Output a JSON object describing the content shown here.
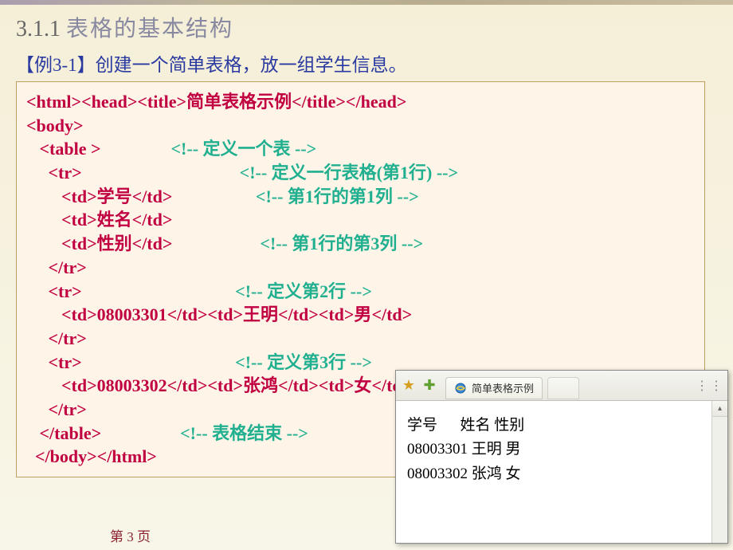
{
  "section": {
    "number": "3.1.1",
    "title": "表格的基本结构"
  },
  "example": {
    "label": "【例3-1】创建一个简单表格，放一组学生信息。"
  },
  "code": {
    "l1a": "<html><head><title>",
    "l1b": "简单表格示例",
    "l1c": "</title></head>",
    "l2": "<body>",
    "l3a": "   <table >",
    "l3b": "                <!-- 定义一个表 -->",
    "l4a": "     <tr>",
    "l4b": "                                    <!-- 定义一行表格(第1行) -->",
    "l5a": "        <td>",
    "l5b": "学号",
    "l5c": "</td>",
    "l5d": "                   <!-- 第1行的第1列 -->",
    "l6a": "        <td>",
    "l6b": "姓名",
    "l6c": "</td>",
    "l7a": "        <td>",
    "l7b": "性别",
    "l7c": "</td>",
    "l7d": "                    <!-- 第1行的第3列 -->",
    "l8": "     </tr>",
    "l9a": "     <tr>",
    "l9b": "                                   <!-- 定义第2行 -->",
    "l10a": "        <td>08003301</td><td>",
    "l10b": "王明",
    "l10c": "</td><td>",
    "l10d": "男",
    "l10e": "</td>",
    "l11": "     </tr>",
    "l12a": "     <tr>",
    "l12b": "                                   <!-- 定义第3行 -->",
    "l13a": "        <td>08003302</td><td>",
    "l13b": "张鸿",
    "l13c": "</td><td>",
    "l13d": "女",
    "l13e": "</td>",
    "l14": "     </tr>",
    "l15a": "   </table>",
    "l15b": "                  <!-- 表格结束 -->",
    "l16": "  </body></html>"
  },
  "browser": {
    "tab_title": "简单表格示例",
    "row1": "学号      姓名 性别",
    "row2": "08003301 王明 男",
    "row3": "08003302 张鸿 女",
    "scroll_up": "▴"
  },
  "footer": {
    "page_left": "第 ",
    "page_num": "3",
    "page_right": " 页"
  }
}
